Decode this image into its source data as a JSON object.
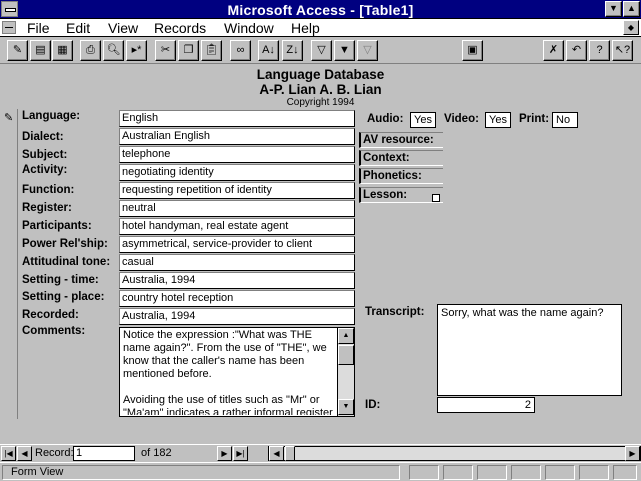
{
  "window": {
    "title": "Microsoft Access - [Table1]"
  },
  "menu": {
    "items": [
      {
        "label": "File"
      },
      {
        "label": "Edit"
      },
      {
        "label": "View"
      },
      {
        "label": "Records"
      },
      {
        "label": "Window"
      },
      {
        "label": "Help"
      }
    ]
  },
  "toolbar": {
    "icons": [
      "design-view-icon",
      "form-view-icon",
      "datasheet-view-icon",
      "print-icon",
      "print-preview-icon",
      "new-record-icon",
      "cut-icon",
      "copy-icon",
      "paste-icon",
      "find-icon",
      "sort-ascending-icon",
      "sort-descending-icon",
      "filter-by-form-icon",
      "apply-filter-icon",
      "remove-filter-icon",
      "database-window-icon",
      "delete-icon",
      "undo-icon",
      "help-icon",
      "context-help-icon"
    ]
  },
  "form": {
    "heading": "Language Database",
    "authors": "A-P. Lian  A. B. Lian",
    "copyright": "Copyright 1994",
    "fields": [
      {
        "label": "Language:",
        "value": "English"
      },
      {
        "label": "Dialect:",
        "value": "Australian English"
      },
      {
        "label": "Subject:",
        "value": "telephone"
      },
      {
        "label": "Activity:",
        "value": "negotiating identity"
      },
      {
        "label": "Function:",
        "value": "requesting repetition of identity"
      },
      {
        "label": "Register:",
        "value": "neutral"
      },
      {
        "label": "Participants:",
        "value": "hotel handyman, real estate agent"
      },
      {
        "label": "Power Rel'ship:",
        "value": "asymmetrical, service-provider to client"
      },
      {
        "label": "Attitudinal tone:",
        "value": "casual"
      },
      {
        "label": "Setting - time:",
        "value": "Australia, 1994"
      },
      {
        "label": "Setting - place:",
        "value": "country hotel reception"
      },
      {
        "label": "Recorded:",
        "value": "Australia, 1994"
      }
    ],
    "comments": {
      "label": "Comments:",
      "paragraph1": "Notice the expression :\"What was THE name again?\". From the use of \"THE\", we know that the caller's name has been mentioned before.",
      "paragraph2": "Avoiding the use of titles such as \"Mr\" or \"Ma'am\" indicates a rather informal register"
    },
    "media": {
      "audio_label": "Audio:",
      "audio_value": "Yes",
      "video_label": "Video:",
      "video_value": "Yes",
      "print_label": "Print:",
      "print_value": "No"
    },
    "resources": [
      {
        "label": "AV resource:"
      },
      {
        "label": "Context:"
      },
      {
        "label": "Phonetics:"
      },
      {
        "label": "Lesson:"
      }
    ],
    "transcript": {
      "label": "Transcript:",
      "value": "Sorry, what was the name again?"
    },
    "id": {
      "label": "ID:",
      "value": "2"
    }
  },
  "navigation": {
    "record_label": "Record:",
    "current": "1",
    "of_label": "of  182"
  },
  "status": {
    "text": "Form View"
  },
  "colors": {
    "titlebar": "#000080",
    "face": "#c0c0c0"
  }
}
